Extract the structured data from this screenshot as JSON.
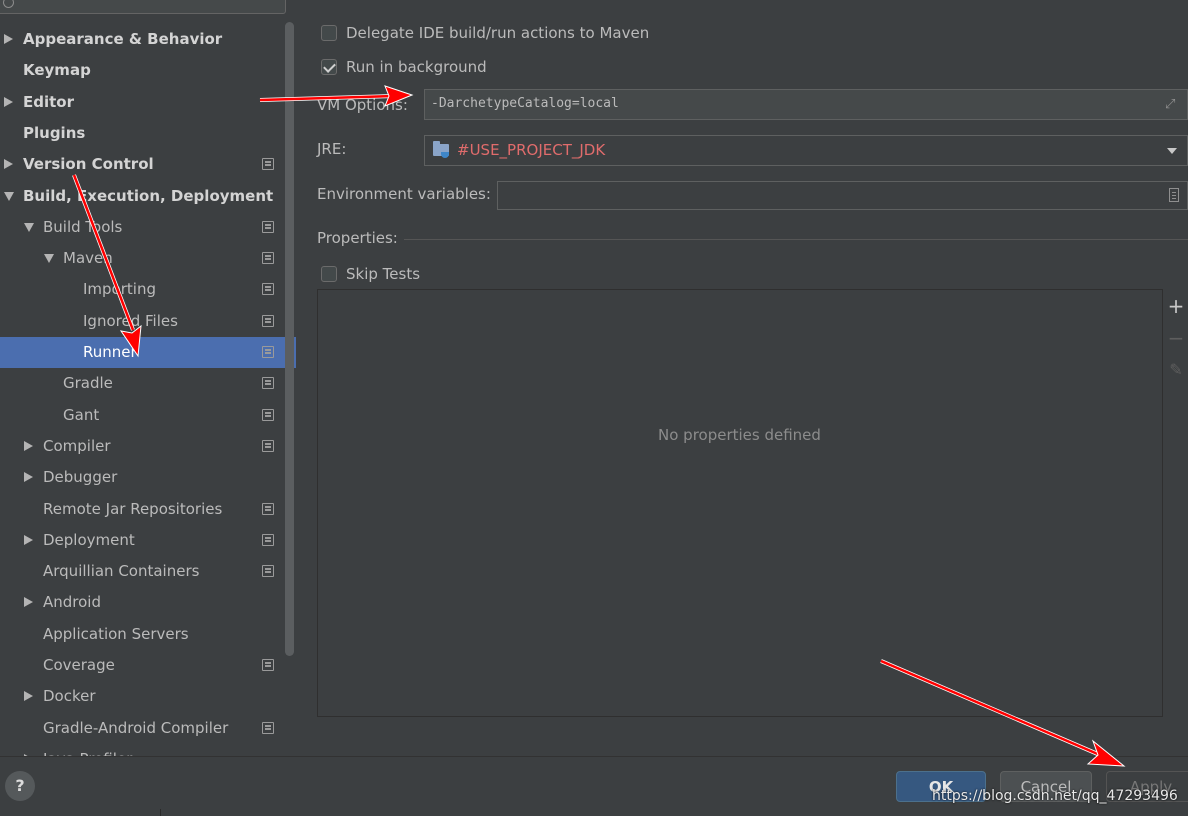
{
  "sidebar": {
    "items": [
      {
        "label": "Appearance & Behavior",
        "level": 0,
        "bold": true,
        "expander": "right",
        "project_icon": false,
        "selected": false
      },
      {
        "label": "Keymap",
        "level": 0,
        "bold": true,
        "expander": "none",
        "project_icon": false,
        "selected": false
      },
      {
        "label": "Editor",
        "level": 0,
        "bold": true,
        "expander": "right",
        "project_icon": false,
        "selected": false
      },
      {
        "label": "Plugins",
        "level": 0,
        "bold": true,
        "expander": "none",
        "project_icon": false,
        "selected": false
      },
      {
        "label": "Version Control",
        "level": 0,
        "bold": true,
        "expander": "right",
        "project_icon": true,
        "selected": false
      },
      {
        "label": "Build, Execution, Deployment",
        "level": 0,
        "bold": true,
        "expander": "down",
        "project_icon": false,
        "selected": false
      },
      {
        "label": "Build Tools",
        "level": 1,
        "bold": false,
        "expander": "down",
        "project_icon": true,
        "selected": false
      },
      {
        "label": "Maven",
        "level": 2,
        "bold": false,
        "expander": "down",
        "project_icon": true,
        "selected": false
      },
      {
        "label": "Importing",
        "level": 3,
        "bold": false,
        "expander": "none",
        "project_icon": true,
        "selected": false
      },
      {
        "label": "Ignored Files",
        "level": 3,
        "bold": false,
        "expander": "none",
        "project_icon": true,
        "selected": false
      },
      {
        "label": "Runner",
        "level": 3,
        "bold": false,
        "expander": "none",
        "project_icon": true,
        "selected": true
      },
      {
        "label": "Gradle",
        "level": 2,
        "bold": false,
        "expander": "none",
        "project_icon": true,
        "selected": false
      },
      {
        "label": "Gant",
        "level": 2,
        "bold": false,
        "expander": "none",
        "project_icon": true,
        "selected": false
      },
      {
        "label": "Compiler",
        "level": 1,
        "bold": false,
        "expander": "right",
        "project_icon": true,
        "selected": false
      },
      {
        "label": "Debugger",
        "level": 1,
        "bold": false,
        "expander": "right",
        "project_icon": false,
        "selected": false
      },
      {
        "label": "Remote Jar Repositories",
        "level": 1,
        "bold": false,
        "expander": "none",
        "project_icon": true,
        "selected": false
      },
      {
        "label": "Deployment",
        "level": 1,
        "bold": false,
        "expander": "right",
        "project_icon": true,
        "selected": false
      },
      {
        "label": "Arquillian Containers",
        "level": 1,
        "bold": false,
        "expander": "none",
        "project_icon": true,
        "selected": false
      },
      {
        "label": "Android",
        "level": 1,
        "bold": false,
        "expander": "right",
        "project_icon": false,
        "selected": false
      },
      {
        "label": "Application Servers",
        "level": 1,
        "bold": false,
        "expander": "none",
        "project_icon": false,
        "selected": false
      },
      {
        "label": "Coverage",
        "level": 1,
        "bold": false,
        "expander": "none",
        "project_icon": true,
        "selected": false
      },
      {
        "label": "Docker",
        "level": 1,
        "bold": false,
        "expander": "right",
        "project_icon": false,
        "selected": false
      },
      {
        "label": "Gradle-Android Compiler",
        "level": 1,
        "bold": false,
        "expander": "none",
        "project_icon": true,
        "selected": false
      },
      {
        "label": "Java Profiler",
        "level": 1,
        "bold": false,
        "expander": "right",
        "project_icon": false,
        "selected": false
      }
    ]
  },
  "runner": {
    "delegate_label": "Delegate IDE build/run actions to Maven",
    "delegate_checked": false,
    "background_label": "Run in background",
    "background_checked": true,
    "vm_options_label": "VM Options:",
    "vm_options_value": "-DarchetypeCatalog=local",
    "jre_label": "JRE:",
    "jre_value": "#USE_PROJECT_JDK",
    "env_label": "Environment variables:",
    "env_value": "",
    "properties_label": "Properties:",
    "skip_tests_label": "Skip Tests",
    "skip_tests_checked": false,
    "empty_message": "No properties defined"
  },
  "footer": {
    "help_label": "?",
    "ok_label": "OK",
    "cancel_label": "Cancel",
    "apply_label": "Apply",
    "watermark": "https://blog.csdn.net/qq_47293496"
  },
  "colors": {
    "background": "#3c3f41",
    "selection": "#4b6eaf",
    "jre_text": "#e06c6c",
    "ok_button": "#365880",
    "annotation_arrow": "#ff0000"
  },
  "icons": {
    "expand": "expand-icon",
    "env_edit": "document-icon",
    "add": "plus-icon",
    "remove": "minus-icon",
    "edit": "pencil-icon",
    "jre": "folder-java-icon",
    "project_scope": "project-scope-icon"
  }
}
